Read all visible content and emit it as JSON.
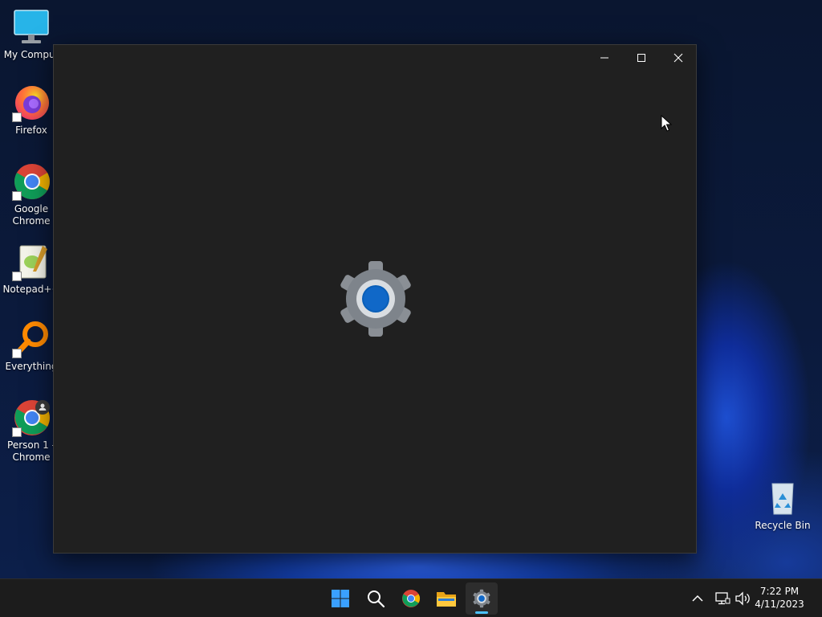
{
  "desktop": {
    "icons": [
      {
        "label": "My Comput",
        "icon": "monitor-icon"
      },
      {
        "label": "Firefox",
        "icon": "firefox-icon"
      },
      {
        "label": "Google\nChrome",
        "icon": "chrome-icon"
      },
      {
        "label": "Notepad++",
        "icon": "notepad-plus-plus-icon"
      },
      {
        "label": "Everything",
        "icon": "everything-search-icon"
      },
      {
        "label": "Person 1 -\nChrome",
        "icon": "chrome-profile-icon"
      },
      {
        "label": "Recycle Bin",
        "icon": "recycle-bin-icon"
      }
    ]
  },
  "window": {
    "app": "Settings",
    "splash_icon": "settings-gear-icon",
    "controls": [
      "minimize-icon",
      "maximize-icon",
      "close-icon"
    ]
  },
  "taskbar": {
    "apps": [
      "start-icon",
      "search-icon",
      "chrome-icon",
      "file-explorer-icon",
      "settings-gear-icon"
    ],
    "active_app": "settings-gear-icon",
    "tray": [
      "chevron-up-icon",
      "network-icon",
      "volume-icon"
    ],
    "clock": {
      "time": "7:22 PM",
      "date": "4/11/2023"
    }
  },
  "colors": {
    "window_bg": "#202020",
    "taskbar_bg": "#1c1c1c",
    "accent": "#0067c0",
    "active_indicator": "#4cc2ff"
  }
}
